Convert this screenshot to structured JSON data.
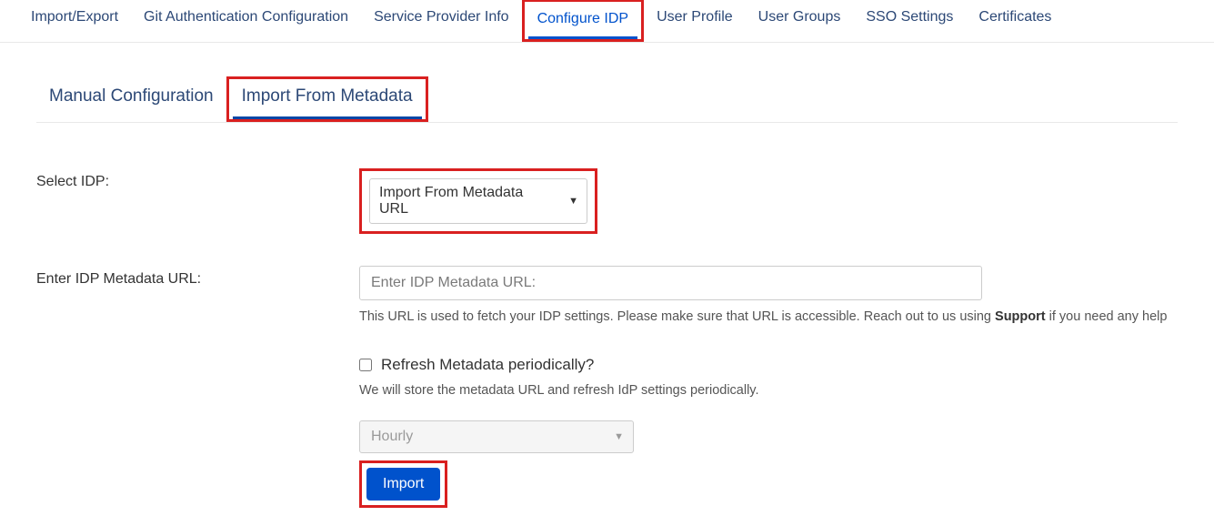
{
  "top_tabs": {
    "import_export": "Import/Export",
    "git_auth": "Git Authentication Configuration",
    "service_provider": "Service Provider Info",
    "configure_idp": "Configure IDP",
    "user_profile": "User Profile",
    "user_groups": "User Groups",
    "sso_settings": "SSO Settings",
    "certificates": "Certificates"
  },
  "sub_tabs": {
    "manual": "Manual Configuration",
    "import_meta": "Import From Metadata"
  },
  "form": {
    "select_idp_label": "Select IDP:",
    "select_idp_value": "Import From Metadata URL",
    "metadata_url_label": "Enter IDP Metadata URL:",
    "metadata_url_placeholder": "Enter IDP Metadata URL:",
    "metadata_url_helper_prefix": "This URL is used to fetch your IDP settings. Please make sure that URL is accessible. Reach out to us using ",
    "metadata_url_helper_strong": "Support",
    "metadata_url_helper_suffix": " if you need any help",
    "refresh_label": "Refresh Metadata periodically?",
    "refresh_helper": "We will store the metadata URL and refresh IdP settings periodically.",
    "frequency_value": "Hourly",
    "import_button": "Import"
  }
}
